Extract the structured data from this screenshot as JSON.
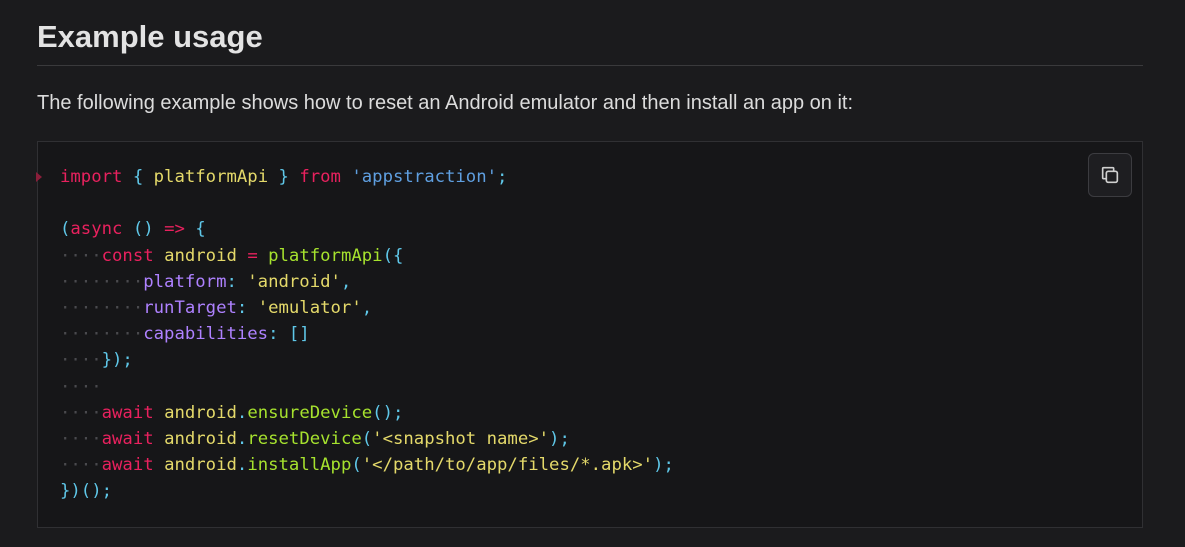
{
  "section": {
    "title": "Example usage",
    "intro": "The following example shows how to reset an Android emulator and then install an app on it:"
  },
  "code": {
    "copy_icon": "copy-icon",
    "tokens": {
      "import": "import",
      "lbrace": "{",
      "platformApi": "platformApi",
      "rbrace": "}",
      "from": "from",
      "module": "'appstraction'",
      "semi": ";",
      "async_open": "(",
      "async": "async",
      "arrow_params": "()",
      "arrow": "=>",
      "block_open": "{",
      "const": "const",
      "android": "android",
      "eq": "=",
      "call_fn": "platformApi",
      "call_open": "({",
      "platform_key": "platform",
      "colon": ":",
      "platform_val": "'android'",
      "comma": ",",
      "runTarget_key": "runTarget",
      "runTarget_val": "'emulator'",
      "capabilities_key": "capabilities",
      "capabilities_val": "[]",
      "call_close": "});",
      "await": "await",
      "ensureDevice": "ensureDevice",
      "resetDevice": "resetDevice",
      "snapshot_arg": "'<snapshot name>'",
      "installApp": "installApp",
      "apk_arg": "'</path/to/app/files/*.apk>'",
      "iife_close": "})();",
      "dot": ".",
      "empty_parens": "()",
      "lparen": "(",
      "rparen": ")"
    }
  }
}
